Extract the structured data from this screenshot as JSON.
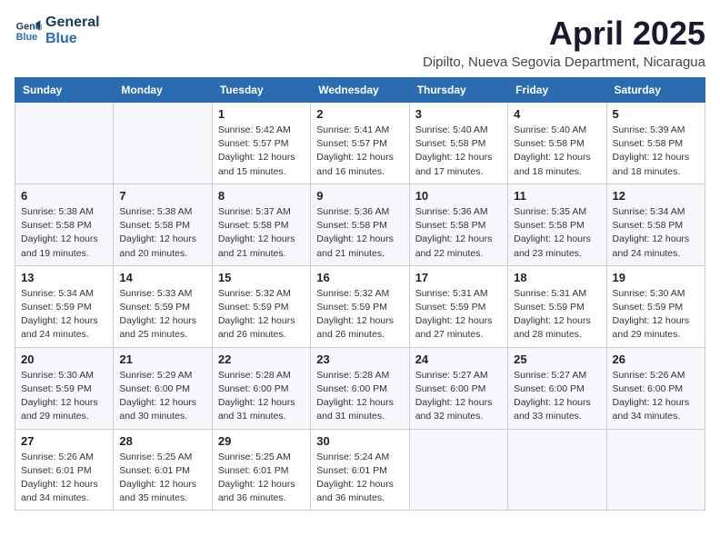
{
  "header": {
    "logo_line1": "General",
    "logo_line2": "Blue",
    "month_year": "April 2025",
    "location": "Dipilto, Nueva Segovia Department, Nicaragua"
  },
  "weekdays": [
    "Sunday",
    "Monday",
    "Tuesday",
    "Wednesday",
    "Thursday",
    "Friday",
    "Saturday"
  ],
  "weeks": [
    [
      {
        "day": null,
        "info": null
      },
      {
        "day": null,
        "info": null
      },
      {
        "day": "1",
        "info": "Sunrise: 5:42 AM\nSunset: 5:57 PM\nDaylight: 12 hours and 15 minutes."
      },
      {
        "day": "2",
        "info": "Sunrise: 5:41 AM\nSunset: 5:57 PM\nDaylight: 12 hours and 16 minutes."
      },
      {
        "day": "3",
        "info": "Sunrise: 5:40 AM\nSunset: 5:58 PM\nDaylight: 12 hours and 17 minutes."
      },
      {
        "day": "4",
        "info": "Sunrise: 5:40 AM\nSunset: 5:58 PM\nDaylight: 12 hours and 18 minutes."
      },
      {
        "day": "5",
        "info": "Sunrise: 5:39 AM\nSunset: 5:58 PM\nDaylight: 12 hours and 18 minutes."
      }
    ],
    [
      {
        "day": "6",
        "info": "Sunrise: 5:38 AM\nSunset: 5:58 PM\nDaylight: 12 hours and 19 minutes."
      },
      {
        "day": "7",
        "info": "Sunrise: 5:38 AM\nSunset: 5:58 PM\nDaylight: 12 hours and 20 minutes."
      },
      {
        "day": "8",
        "info": "Sunrise: 5:37 AM\nSunset: 5:58 PM\nDaylight: 12 hours and 21 minutes."
      },
      {
        "day": "9",
        "info": "Sunrise: 5:36 AM\nSunset: 5:58 PM\nDaylight: 12 hours and 21 minutes."
      },
      {
        "day": "10",
        "info": "Sunrise: 5:36 AM\nSunset: 5:58 PM\nDaylight: 12 hours and 22 minutes."
      },
      {
        "day": "11",
        "info": "Sunrise: 5:35 AM\nSunset: 5:58 PM\nDaylight: 12 hours and 23 minutes."
      },
      {
        "day": "12",
        "info": "Sunrise: 5:34 AM\nSunset: 5:58 PM\nDaylight: 12 hours and 24 minutes."
      }
    ],
    [
      {
        "day": "13",
        "info": "Sunrise: 5:34 AM\nSunset: 5:59 PM\nDaylight: 12 hours and 24 minutes."
      },
      {
        "day": "14",
        "info": "Sunrise: 5:33 AM\nSunset: 5:59 PM\nDaylight: 12 hours and 25 minutes."
      },
      {
        "day": "15",
        "info": "Sunrise: 5:32 AM\nSunset: 5:59 PM\nDaylight: 12 hours and 26 minutes."
      },
      {
        "day": "16",
        "info": "Sunrise: 5:32 AM\nSunset: 5:59 PM\nDaylight: 12 hours and 26 minutes."
      },
      {
        "day": "17",
        "info": "Sunrise: 5:31 AM\nSunset: 5:59 PM\nDaylight: 12 hours and 27 minutes."
      },
      {
        "day": "18",
        "info": "Sunrise: 5:31 AM\nSunset: 5:59 PM\nDaylight: 12 hours and 28 minutes."
      },
      {
        "day": "19",
        "info": "Sunrise: 5:30 AM\nSunset: 5:59 PM\nDaylight: 12 hours and 29 minutes."
      }
    ],
    [
      {
        "day": "20",
        "info": "Sunrise: 5:30 AM\nSunset: 5:59 PM\nDaylight: 12 hours and 29 minutes."
      },
      {
        "day": "21",
        "info": "Sunrise: 5:29 AM\nSunset: 6:00 PM\nDaylight: 12 hours and 30 minutes."
      },
      {
        "day": "22",
        "info": "Sunrise: 5:28 AM\nSunset: 6:00 PM\nDaylight: 12 hours and 31 minutes."
      },
      {
        "day": "23",
        "info": "Sunrise: 5:28 AM\nSunset: 6:00 PM\nDaylight: 12 hours and 31 minutes."
      },
      {
        "day": "24",
        "info": "Sunrise: 5:27 AM\nSunset: 6:00 PM\nDaylight: 12 hours and 32 minutes."
      },
      {
        "day": "25",
        "info": "Sunrise: 5:27 AM\nSunset: 6:00 PM\nDaylight: 12 hours and 33 minutes."
      },
      {
        "day": "26",
        "info": "Sunrise: 5:26 AM\nSunset: 6:00 PM\nDaylight: 12 hours and 34 minutes."
      }
    ],
    [
      {
        "day": "27",
        "info": "Sunrise: 5:26 AM\nSunset: 6:01 PM\nDaylight: 12 hours and 34 minutes."
      },
      {
        "day": "28",
        "info": "Sunrise: 5:25 AM\nSunset: 6:01 PM\nDaylight: 12 hours and 35 minutes."
      },
      {
        "day": "29",
        "info": "Sunrise: 5:25 AM\nSunset: 6:01 PM\nDaylight: 12 hours and 36 minutes."
      },
      {
        "day": "30",
        "info": "Sunrise: 5:24 AM\nSunset: 6:01 PM\nDaylight: 12 hours and 36 minutes."
      },
      {
        "day": null,
        "info": null
      },
      {
        "day": null,
        "info": null
      },
      {
        "day": null,
        "info": null
      }
    ]
  ]
}
